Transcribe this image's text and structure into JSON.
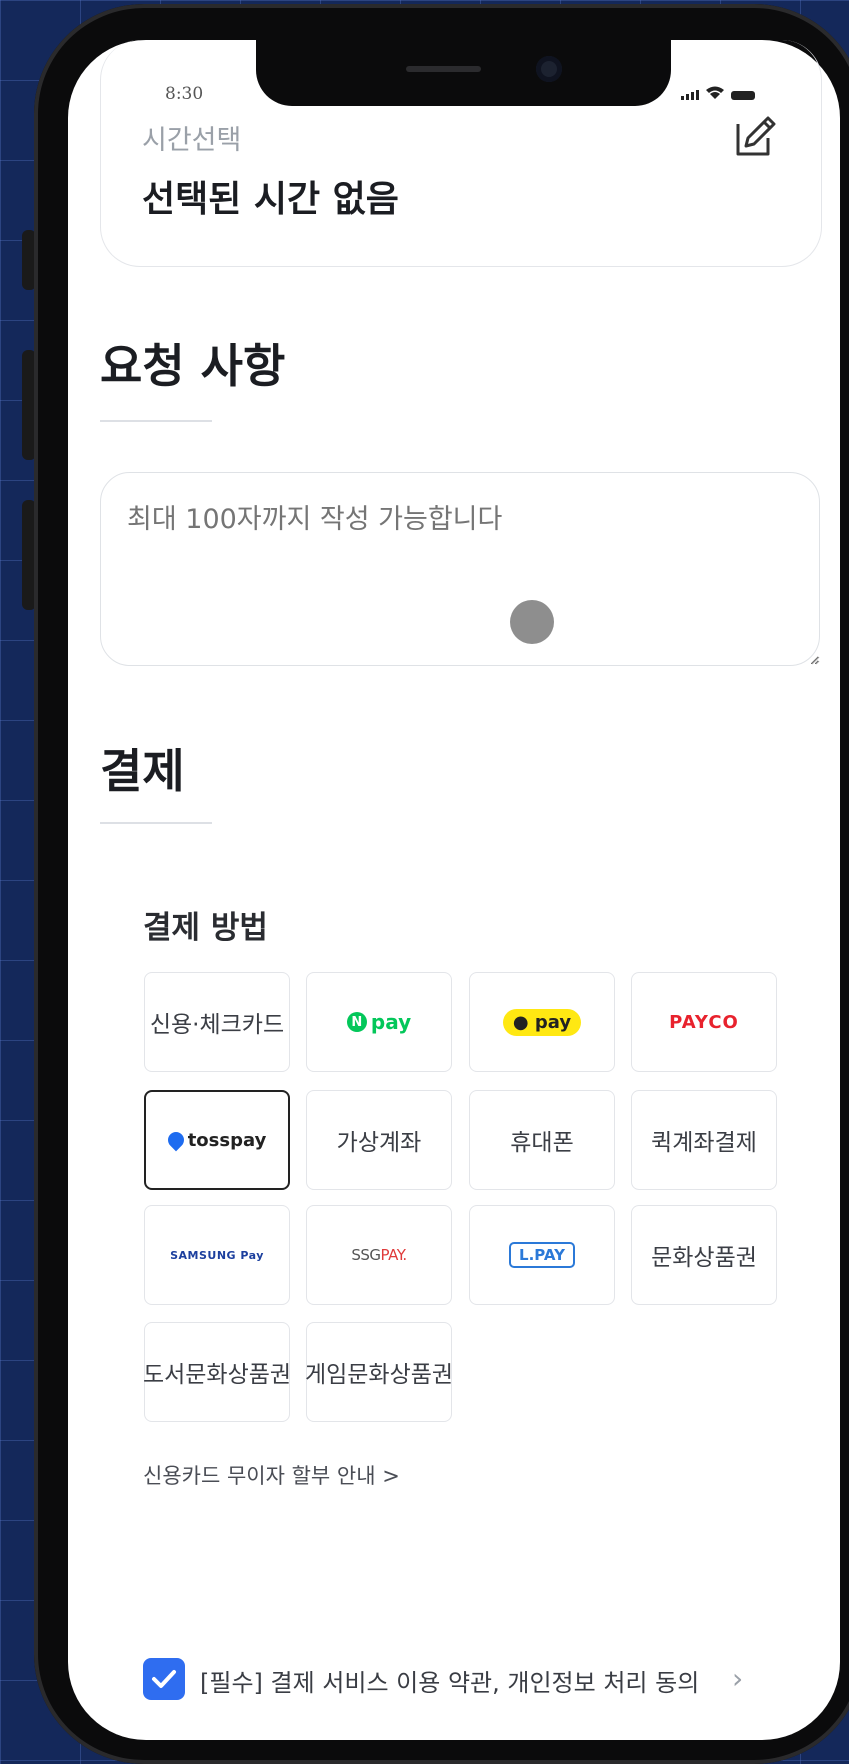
{
  "status_bar": {
    "time": "8:30"
  },
  "time_select": {
    "label": "시간선택",
    "value": "선택된 시간 없음"
  },
  "request": {
    "title": "요청 사항",
    "placeholder": "최대 100자까지 작성 가능합니다"
  },
  "payment": {
    "title": "결제",
    "method_label": "결제 방법",
    "methods": [
      {
        "label": "신용·체크카드"
      },
      {
        "label": "pay",
        "icon": "npay-logo"
      },
      {
        "label": "pay",
        "icon": "kakaopay-logo"
      },
      {
        "label": "PAYCO",
        "icon": "payco-logo"
      },
      {
        "label": "tosspay",
        "icon": "tosspay-logo",
        "selected": true
      },
      {
        "label": "가상계좌"
      },
      {
        "label": "휴대폰"
      },
      {
        "label": "퀵계좌결제"
      },
      {
        "label": "SAMSUNG Pay",
        "icon": "samsungpay-logo"
      },
      {
        "label_a": "SSG",
        "label_b": "PAY.",
        "icon": "ssgpay-logo"
      },
      {
        "label": "L.PAY",
        "icon": "lpay-logo"
      },
      {
        "label": "문화상품권"
      },
      {
        "label": "도서문화상품권"
      },
      {
        "label": "게임문화상품권"
      }
    ],
    "installment_link": "신용카드 무이자 할부 안내 >",
    "terms_label": "[필수] 결제 서비스 이용 약관, 개인정보 처리 동의",
    "terms_checked": true,
    "colors": {
      "accent": "#2f6df0",
      "npay": "#03c75a",
      "kakao": "#ffe812",
      "payco": "#e8222d"
    }
  }
}
